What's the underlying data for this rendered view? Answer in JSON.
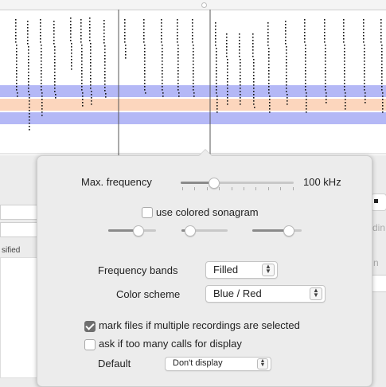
{
  "popover": {
    "max_frequency_label": "Max. frequency",
    "max_frequency_value": "100 kHz",
    "max_frequency_slider_fraction": 0.29,
    "use_colored_sonagram_label": "use colored sonagram",
    "use_colored_sonagram_checked": false,
    "slider1_fraction": 0.62,
    "slider2_fraction": 0.18,
    "slider3_fraction": 0.72,
    "frequency_bands_label": "Frequency bands",
    "frequency_bands_value": "Filled",
    "color_scheme_label": "Color scheme",
    "color_scheme_value": "Blue / Red",
    "mark_files_label": "mark files if multiple recordings are selected",
    "mark_files_checked": true,
    "ask_too_many_label": "ask if too many calls for display",
    "ask_too_many_checked": false,
    "default_label": "Default",
    "default_value": "Don't display"
  },
  "background": {
    "left_fragment": "sified",
    "right_fragment_1": "din",
    "right_fragment_2": "n"
  },
  "colors": {
    "band_blue": "#b4b8f6",
    "band_orange": "#fcd6bd",
    "cursor_line": "#555555"
  }
}
